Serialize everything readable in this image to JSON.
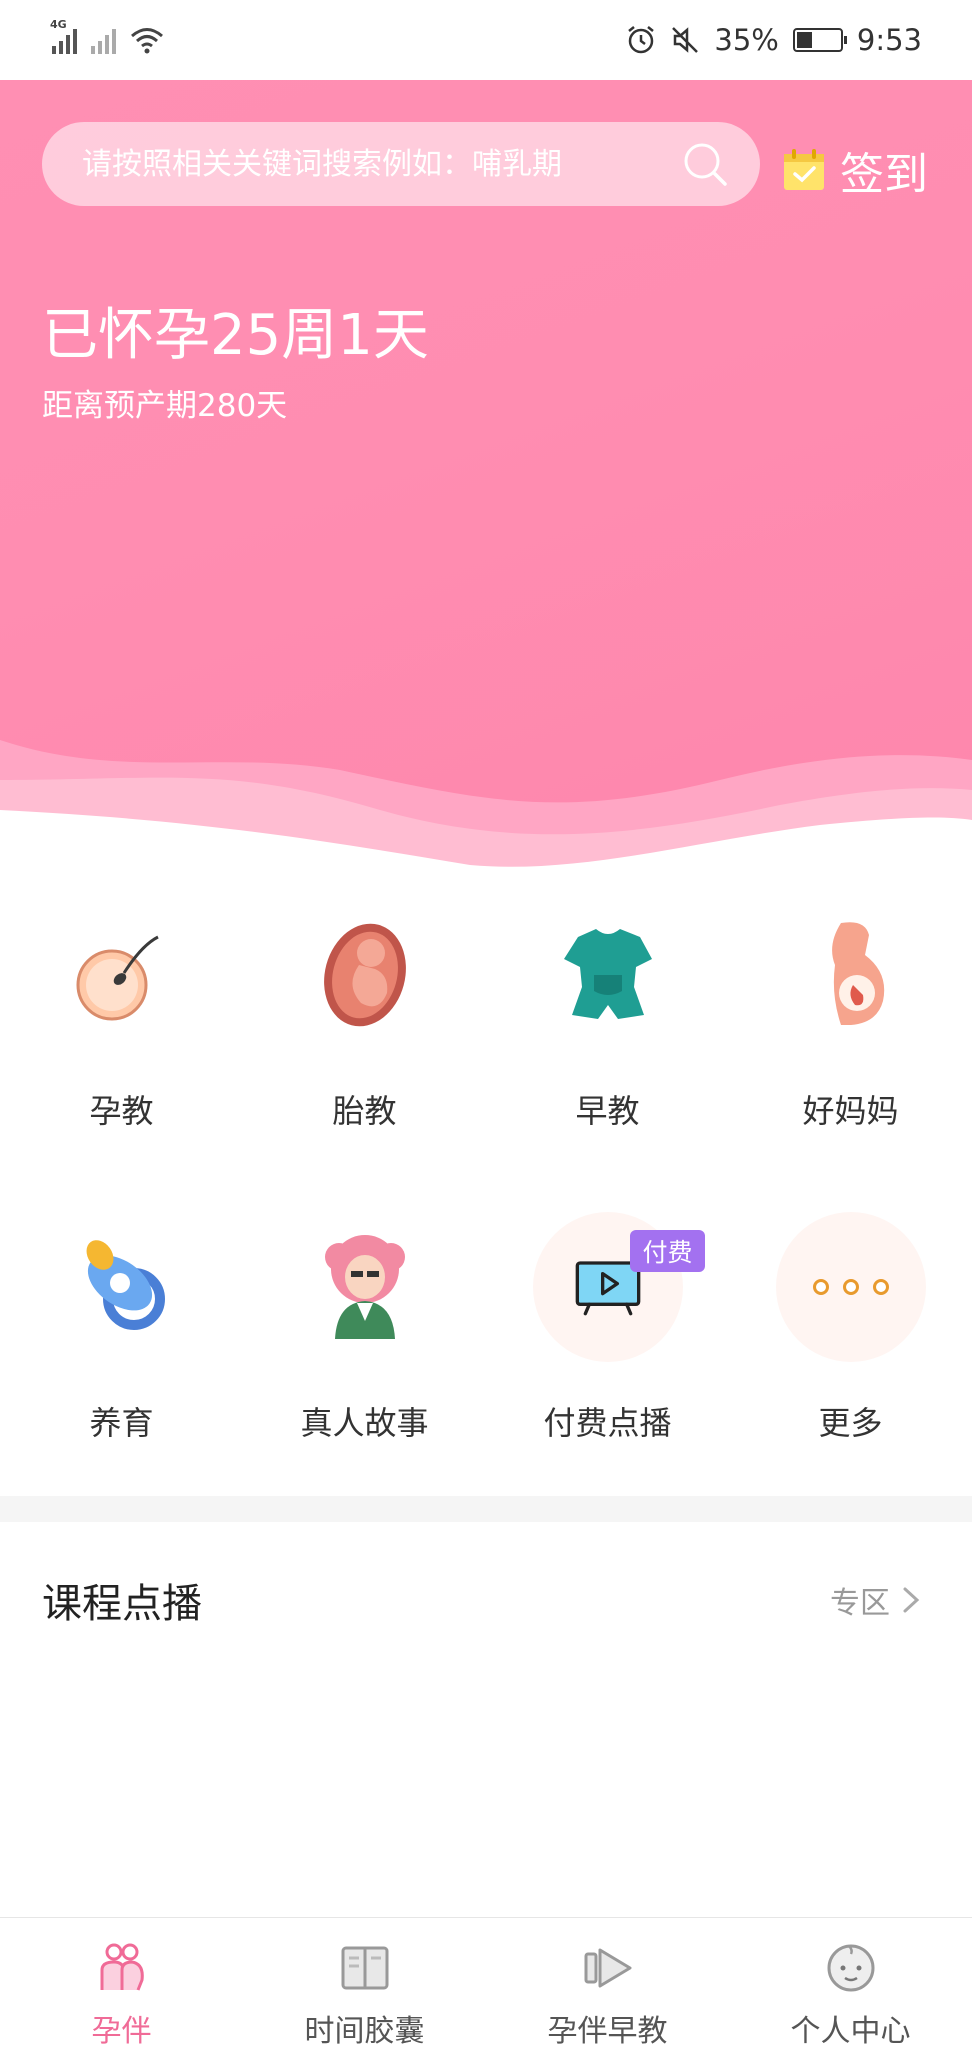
{
  "status_bar": {
    "network_label": "4G",
    "battery": "35%",
    "time": "9:53",
    "battery_level": 0.35,
    "icons": [
      "signal-icon",
      "signal-off-icon",
      "wifi-icon",
      "alarm-icon",
      "mute-icon",
      "battery-icon"
    ]
  },
  "header": {
    "search_placeholder": "请按照相关关键词搜索例如：哺乳期",
    "checkin_label": "签到",
    "pregnancy_title": "已怀孕25周1天",
    "due_date_text": "距离预产期280天",
    "accent_color": "#ff8db1"
  },
  "grid": {
    "items": [
      {
        "label": "孕教",
        "icon": "egg-sperm-icon"
      },
      {
        "label": "胎教",
        "icon": "fetus-icon"
      },
      {
        "label": "早教",
        "icon": "baby-onesie-icon"
      },
      {
        "label": "好妈妈",
        "icon": "pregnant-belly-icon"
      },
      {
        "label": "养育",
        "icon": "pacifier-icon"
      },
      {
        "label": "真人故事",
        "icon": "girl-avatar-icon"
      },
      {
        "label": "付费点播",
        "icon": "tv-play-icon",
        "badge": "付费"
      },
      {
        "label": "更多",
        "icon": "more-dots-icon"
      }
    ]
  },
  "section": {
    "title": "课程点播",
    "more_label": "专区"
  },
  "bottom_nav": {
    "items": [
      {
        "label": "孕伴",
        "icon": "couple-icon",
        "active": true
      },
      {
        "label": "时间胶囊",
        "icon": "book-icon",
        "active": false
      },
      {
        "label": "孕伴早教",
        "icon": "play-icon",
        "active": false
      },
      {
        "label": "个人中心",
        "icon": "baby-face-icon",
        "active": false
      }
    ],
    "active_color": "#f06b97"
  }
}
